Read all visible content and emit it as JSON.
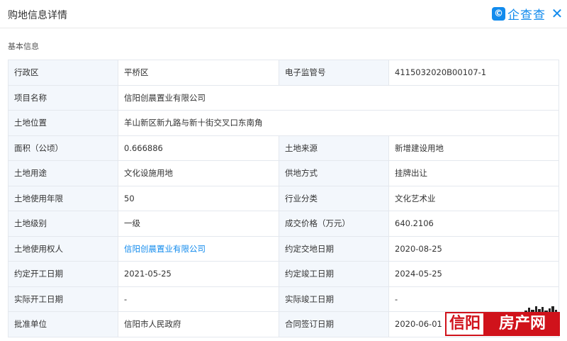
{
  "header": {
    "title": "购地信息详情",
    "brand_icon": "©",
    "brand_text": "企查查",
    "close_glyph": "✕"
  },
  "section": {
    "title": "基本信息"
  },
  "rows": [
    [
      {
        "label": "行政区",
        "value": "平桥区"
      },
      {
        "label": "电子监管号",
        "value": "4115032020B00107-1"
      }
    ],
    [
      {
        "label": "项目名称",
        "value": "信阳创晨置业有限公司"
      }
    ],
    [
      {
        "label": "土地位置",
        "value": "羊山新区新九路与新十街交叉口东南角"
      }
    ],
    [
      {
        "label": "面积（公顷）",
        "value": "0.666886"
      },
      {
        "label": "土地来源",
        "value": "新增建设用地"
      }
    ],
    [
      {
        "label": "土地用途",
        "value": "文化设施用地"
      },
      {
        "label": "供地方式",
        "value": "挂牌出让"
      }
    ],
    [
      {
        "label": "土地使用年限",
        "value": "50"
      },
      {
        "label": "行业分类",
        "value": "文化艺术业"
      }
    ],
    [
      {
        "label": "土地级别",
        "value": "一级"
      },
      {
        "label": "成交价格（万元）",
        "value": "640.2106"
      }
    ],
    [
      {
        "label": "土地使用权人",
        "value": "信阳创晨置业有限公司"
      },
      {
        "label": "约定交地日期",
        "value": "2020-08-25"
      }
    ],
    [
      {
        "label": "约定开工日期",
        "value": "2021-05-25"
      },
      {
        "label": "约定竣工日期",
        "value": "2024-05-25"
      }
    ],
    [
      {
        "label": "实际开工日期",
        "value": "-"
      },
      {
        "label": "实际竣工日期",
        "value": "-"
      }
    ],
    [
      {
        "label": "批准单位",
        "value": "信阳市人民政府"
      },
      {
        "label": "合同签订日期",
        "value": "2020-06-01"
      }
    ]
  ],
  "watermark": {
    "left": "信阳",
    "right": "房产网"
  },
  "colors": {
    "accent": "#128bed",
    "label_bg": "#f3f7fc",
    "border": "#e4e8ee",
    "watermark_red": "#d0121b"
  }
}
